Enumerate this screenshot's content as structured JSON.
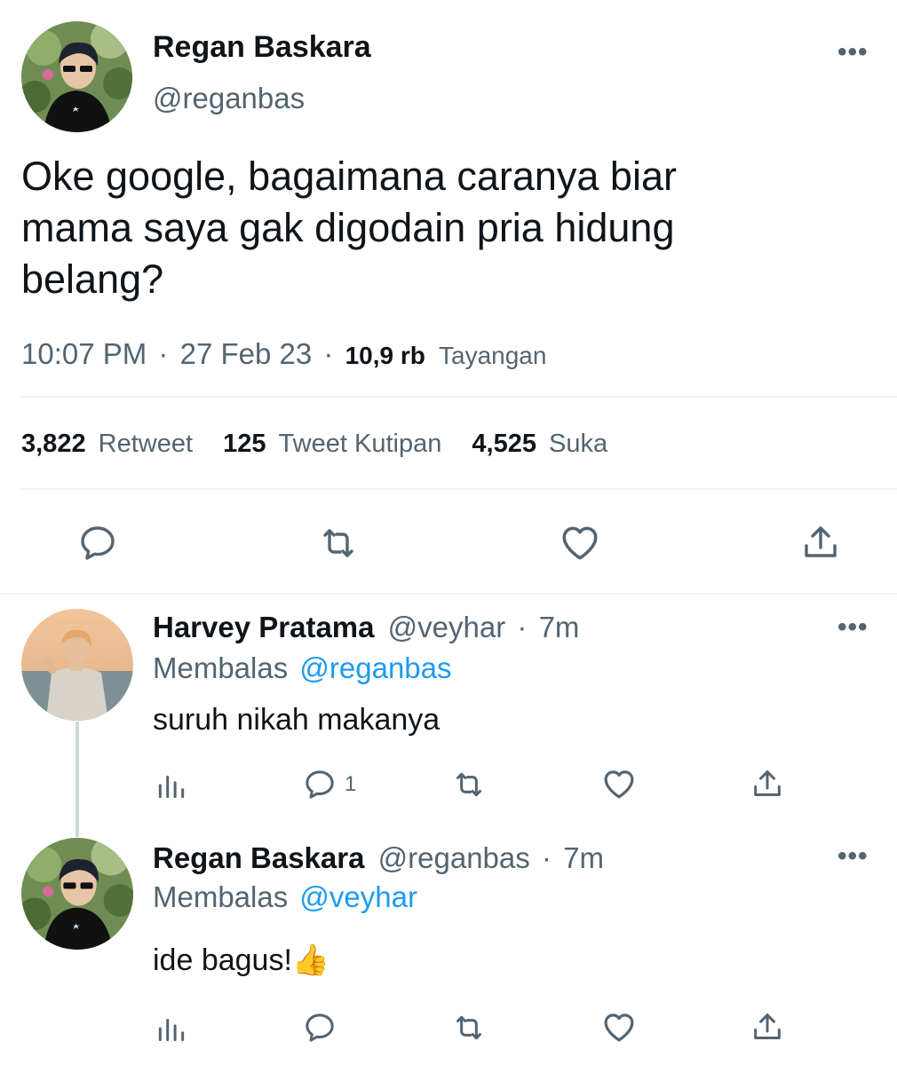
{
  "main_tweet": {
    "author_name": "Regan Baskara",
    "author_handle": "@reganbas",
    "text_line1": "Oke google, bagaimana caranya biar",
    "text_line2": "mama saya gak digodain pria hidung",
    "text_line3": "belang?",
    "time": "10:07 PM",
    "date": "27 Feb 23",
    "separator": "·",
    "views_count": "10,9 rb",
    "views_label": "Tayangan",
    "more_label": "•••",
    "stats": {
      "retweets_count": "3,822",
      "retweets_label": "Retweet",
      "quotes_count": "125",
      "quotes_label": "Tweet Kutipan",
      "likes_count": "4,525",
      "likes_label": "Suka"
    }
  },
  "replies": [
    {
      "author_name": "Harvey Pratama",
      "author_handle": "@veyhar",
      "time_ago": "7m",
      "separator": "·",
      "replying_prefix": "Membalas",
      "replying_to": "@reganbas",
      "text": "suruh nikah makanya",
      "reply_count": "1",
      "more_label": "•••"
    },
    {
      "author_name": "Regan Baskara",
      "author_handle": "@reganbas",
      "time_ago": "7m",
      "separator": "·",
      "replying_prefix": "Membalas",
      "replying_to": "@veyhar",
      "text": "ide bagus!",
      "emoji": "👍",
      "reply_count": "",
      "more_label": "•••"
    }
  ],
  "colors": {
    "accent": "#1d9bf0",
    "text": "#0f1419",
    "muted": "#536471",
    "divider": "#eff3f4",
    "thread_line": "#cfd9de"
  },
  "icons": [
    "reply-icon",
    "retweet-icon",
    "like-icon",
    "share-icon",
    "analytics-icon",
    "more-icon"
  ]
}
